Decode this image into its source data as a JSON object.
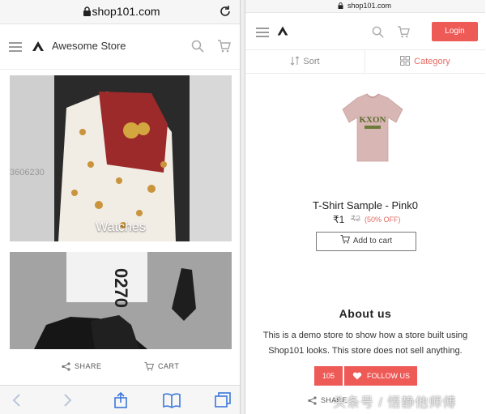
{
  "left_screen": {
    "url": "shop101.com",
    "store_name": "Awesome Store",
    "categories": [
      {
        "label": "Watches"
      },
      {
        "label": ""
      }
    ],
    "photo_text": {
      "tile1_number": "3606230",
      "tile2_box_text": "0270"
    },
    "actions": {
      "share": "SHARE",
      "cart": "CART"
    }
  },
  "right_screen": {
    "url": "shop101.com",
    "login": "Login",
    "tabs": {
      "sort": "Sort",
      "category": "Category"
    },
    "product": {
      "name": "T-Shirt Sample - Pink0",
      "price": "₹1",
      "mrp": "₹2",
      "discount": "(50% OFF)",
      "add_to_cart": "Add to cart",
      "shirt_print": "KXON"
    },
    "about": {
      "title": "About us",
      "text": "This is a demo store to show how a store built using Shop101 looks. This store does not sell anything."
    },
    "follow": {
      "count": "105",
      "label": "FOLLOW US"
    },
    "share": "SHARE"
  },
  "watermark": "头条号 / 悟静他师傅",
  "colors": {
    "accent": "#ee5a56",
    "tab_active": "#e56a62"
  },
  "icons": [
    "lock-icon",
    "reload-icon",
    "hamburger-icon",
    "store-logo-icon",
    "search-icon",
    "cart-icon",
    "share-icon",
    "back-icon",
    "forward-icon",
    "share-sheet-icon",
    "bookmarks-icon",
    "tabs-icon",
    "sort-icon",
    "grid-icon",
    "heart-icon"
  ]
}
